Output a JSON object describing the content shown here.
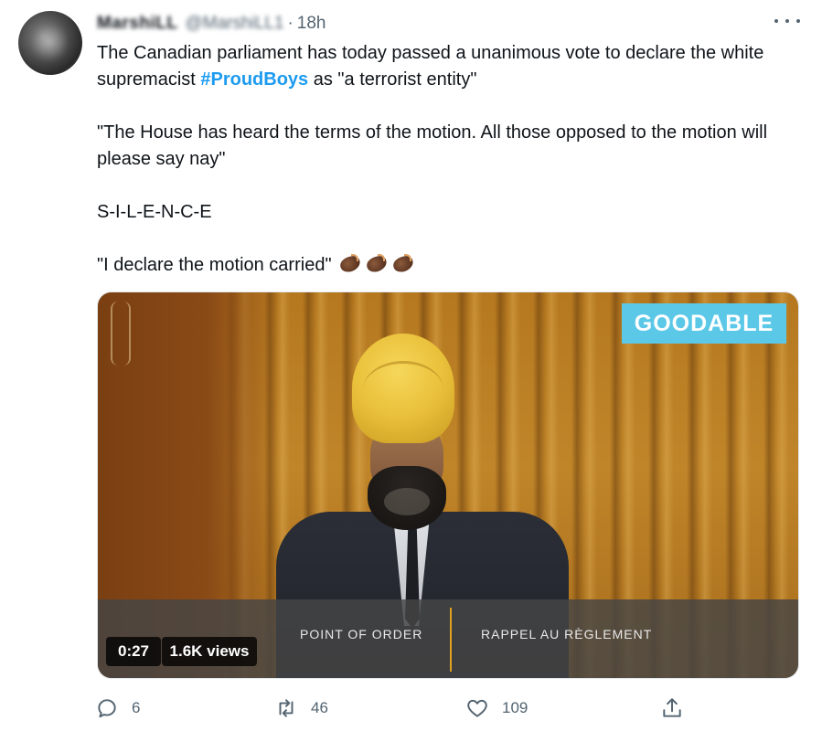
{
  "tweet": {
    "author_name": "MarshiLL",
    "author_handle": "@MarshiLL1",
    "separator": "·",
    "time": "18h",
    "text": {
      "line1_before": "The Canadian parliament has today passed a unanimous vote to declare the white supremacist ",
      "hashtag": "#ProudBoys",
      "line1_after": " as \"a terrorist entity\"",
      "quote1": "\"The House has heard the terms of the motion. All those opposed to the motion will please say nay\"",
      "silence": "S-I-L-E-N-C-E",
      "quote2": "\"I declare the motion carried\""
    },
    "emoji": [
      "clapping-hands-dark-skin-tone",
      "clapping-hands-dark-skin-tone",
      "clapping-hands-dark-skin-tone"
    ]
  },
  "video": {
    "logo": "GOODABLE",
    "lower_third_left": "POINT OF ORDER",
    "lower_third_right": "RAPPEL AU RÈGLEMENT",
    "duration": "0:27",
    "views": "1.6K views"
  },
  "actions": {
    "reply_count": "6",
    "retweet_count": "46",
    "like_count": "109"
  },
  "colors": {
    "text": "#0f1419",
    "secondary": "#536471",
    "hashtag": "#1d9bf0",
    "logo_bg": "#5cc8e8"
  }
}
